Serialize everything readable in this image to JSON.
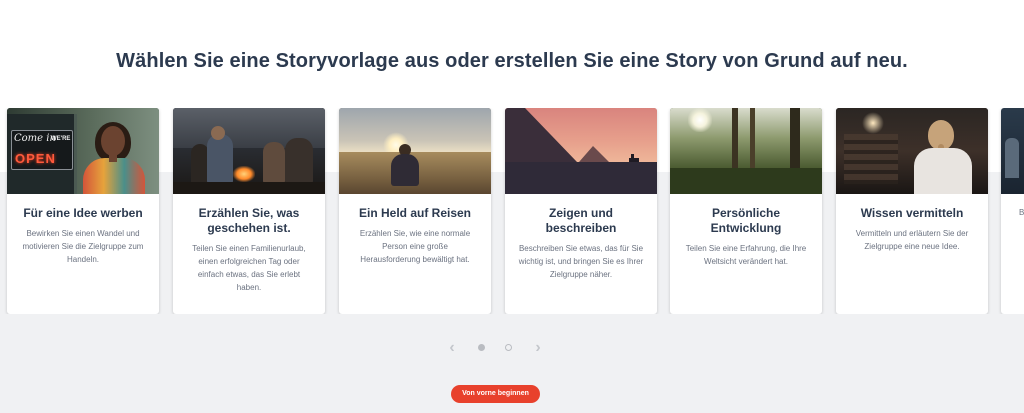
{
  "headline": "Wählen Sie eine Storyvorlage aus oder erstellen Sie eine Story von Grund auf neu.",
  "cards": [
    {
      "title": "Für eine Idee werben",
      "description": "Bewirken Sie einen Wandel und motivieren Sie die Zielgruppe zum Handeln.",
      "sign_top": "Come in",
      "sign_were": "WE'RE",
      "sign_open": "OPEN"
    },
    {
      "title": "Erzählen Sie, was geschehen ist.",
      "description": "Teilen Sie einen Familienurlaub, einen erfolgreichen Tag oder einfach etwas, das Sie erlebt haben."
    },
    {
      "title": "Ein Held auf Reisen",
      "description": "Erzählen Sie, wie eine normale Person eine große Herausforderung bewältigt hat."
    },
    {
      "title": "Zeigen und beschreiben",
      "description": "Beschreiben Sie etwas, das für Sie wichtig ist, und bringen Sie es Ihrer Zielgruppe näher."
    },
    {
      "title": "Persönliche Entwicklung",
      "description": "Teilen Sie eine Erfahrung, die Ihre Weltsicht verändert hat."
    },
    {
      "title": "Wissen vermitteln",
      "description": "Vermitteln und erläutern Sie der Zielgruppe eine neue Idee."
    },
    {
      "title": "",
      "description": "B"
    }
  ],
  "pager": {
    "prev_icon": "chevron-left-icon",
    "next_icon": "chevron-right-icon",
    "pages": 2,
    "current": 1
  },
  "cta_label": "Von vorne beginnen",
  "colors": {
    "headline": "#2c3a4f",
    "cta": "#e8412c",
    "background_lower": "#f0f1f3"
  }
}
